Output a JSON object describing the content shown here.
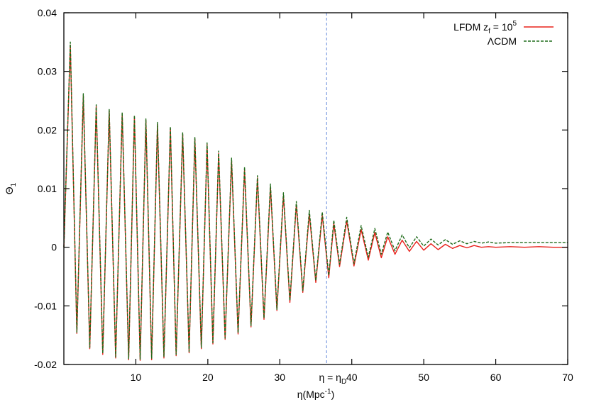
{
  "chart_data": {
    "type": "line",
    "xlabel": "η(Mpc",
    "xlabel_sup": "-1",
    "xlabel_close": ")",
    "ylabel": "Θ",
    "ylabel_sub": "1",
    "xlim": [
      0,
      70
    ],
    "ylim": [
      -0.02,
      0.04
    ],
    "xticks": [
      {
        "value": 10,
        "label": "10"
      },
      {
        "value": 20,
        "label": "20"
      },
      {
        "value": 30,
        "label": "30"
      },
      {
        "value": 40,
        "label": "40"
      },
      {
        "value": 50,
        "label": "50"
      },
      {
        "value": 60,
        "label": "60"
      },
      {
        "value": 70,
        "label": "70"
      }
    ],
    "yticks": [
      {
        "value": -0.02,
        "label": "-0.02"
      },
      {
        "value": -0.01,
        "label": "-0.01"
      },
      {
        "value": 0,
        "label": "0"
      },
      {
        "value": 0.01,
        "label": "0.01"
      },
      {
        "value": 0.02,
        "label": "0.02"
      },
      {
        "value": 0.03,
        "label": "0.03"
      },
      {
        "value": 0.04,
        "label": "0.04"
      }
    ],
    "grid": false,
    "legend_position": "top-right",
    "vline": {
      "x": 36.5,
      "label": "η = η",
      "label_sub": "D",
      "color": "#7b9be0"
    },
    "series": [
      {
        "name": "LFDM z",
        "name_sub": "f",
        "name_rest": " = 10",
        "name_sup": "5",
        "color": "#e8201a",
        "dash": "solid",
        "x": [
          0,
          0.9,
          1.8,
          2.7,
          3.6,
          4.5,
          5.4,
          6.3,
          7.2,
          8.1,
          9.0,
          9.8,
          10.6,
          11.4,
          12.2,
          13.0,
          13.9,
          14.8,
          15.6,
          16.5,
          17.4,
          18.2,
          19.1,
          19.9,
          20.7,
          21.5,
          22.4,
          23.3,
          24.2,
          25.1,
          26.0,
          26.9,
          27.8,
          28.7,
          29.6,
          30.5,
          31.4,
          32.3,
          33.2,
          34.1,
          35.0,
          35.9,
          36.8,
          37.5,
          38.3,
          39.3,
          40.3,
          41.3,
          42.3,
          43.2,
          44.1,
          45.0,
          46.0,
          47.0,
          48.0,
          49.0,
          50.0,
          51.0,
          52.0,
          53.0,
          54.0,
          55.0,
          56.0,
          57.0,
          58.0,
          59.0,
          60.0,
          62.0,
          64.0,
          66.0,
          68.0,
          70.0
        ],
        "y": [
          0,
          0.0345,
          -0.0147,
          0.0258,
          -0.0173,
          0.024,
          -0.0183,
          0.0233,
          -0.0189,
          0.0228,
          -0.0192,
          0.0223,
          -0.0193,
          0.0217,
          -0.0192,
          0.021,
          -0.0189,
          0.0203,
          -0.0185,
          0.0193,
          -0.018,
          0.0185,
          -0.0173,
          0.0175,
          -0.0165,
          0.016,
          -0.0157,
          0.0148,
          -0.0148,
          0.0132,
          -0.0136,
          0.0118,
          -0.0123,
          0.0103,
          -0.0108,
          0.0088,
          -0.0094,
          0.0073,
          -0.0077,
          0.0057,
          -0.006,
          0.0054,
          -0.0052,
          0.004,
          -0.0033,
          0.0045,
          -0.0032,
          0.003,
          -0.0022,
          0.0025,
          -0.0018,
          0.0018,
          -0.0012,
          0.0012,
          -0.0007,
          0.001,
          -0.0005,
          0.0006,
          -0.0004,
          0.0005,
          -0.0002,
          0.0003,
          -0.0001,
          0.0003,
          0.0,
          0.0001,
          0.0,
          0.0001,
          0.0,
          0.0001,
          0.0,
          0.0
        ]
      },
      {
        "name": "ΛCDM",
        "color": "#1f6b1a",
        "dash": "dashed",
        "x": [
          0,
          0.9,
          1.8,
          2.7,
          3.6,
          4.5,
          5.4,
          6.3,
          7.2,
          8.1,
          9.0,
          9.8,
          10.6,
          11.4,
          12.2,
          13.0,
          13.9,
          14.8,
          15.6,
          16.5,
          17.4,
          18.2,
          19.1,
          19.9,
          20.7,
          21.5,
          22.4,
          23.3,
          24.2,
          25.1,
          26.0,
          26.9,
          27.8,
          28.7,
          29.6,
          30.5,
          31.4,
          32.3,
          33.2,
          34.1,
          35.0,
          35.9,
          36.8,
          37.5,
          38.3,
          39.3,
          40.3,
          41.3,
          42.3,
          43.2,
          44.1,
          45.0,
          46.0,
          47.0,
          48.0,
          49.0,
          50.0,
          51.0,
          52.0,
          53.0,
          54.0,
          55.0,
          56.0,
          57.0,
          58.0,
          59.0,
          60.0,
          62.0,
          64.0,
          66.0,
          68.0,
          70.0
        ],
        "y": [
          0,
          0.035,
          -0.0145,
          0.0262,
          -0.0171,
          0.0243,
          -0.0181,
          0.0235,
          -0.0187,
          0.023,
          -0.019,
          0.0225,
          -0.0191,
          0.0219,
          -0.019,
          0.0213,
          -0.0187,
          0.0206,
          -0.0183,
          0.0196,
          -0.0178,
          0.0188,
          -0.0171,
          0.0178,
          -0.0163,
          0.0164,
          -0.0155,
          0.0152,
          -0.0146,
          0.0137,
          -0.0134,
          0.0122,
          -0.0121,
          0.0108,
          -0.0106,
          0.0093,
          -0.0091,
          0.0078,
          -0.0074,
          0.0063,
          -0.0057,
          0.006,
          -0.0048,
          0.0046,
          -0.0029,
          0.0051,
          -0.0028,
          0.0037,
          -0.0017,
          0.0032,
          -0.0012,
          0.0026,
          -0.0006,
          0.0021,
          -0.0001,
          0.0018,
          0.0002,
          0.0014,
          0.0004,
          0.0013,
          0.0005,
          0.0011,
          0.0006,
          0.001,
          0.0007,
          0.0009,
          0.0007,
          0.0008,
          0.0008,
          0.0008,
          0.0008,
          0.0008
        ]
      }
    ]
  }
}
